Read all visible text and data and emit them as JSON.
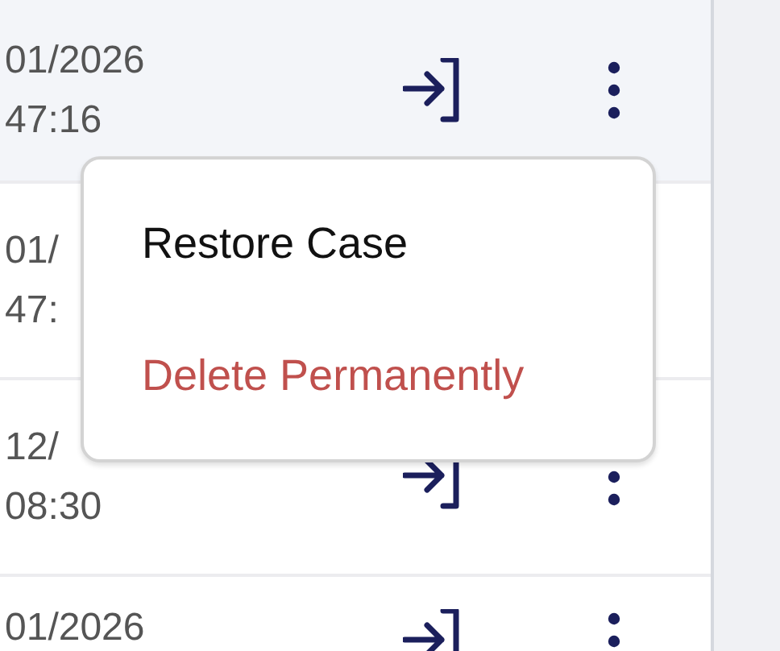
{
  "rows": [
    {
      "date": "01/2026",
      "time": "47:16",
      "selected": true,
      "actions": [
        {
          "kind": "enter"
        },
        {
          "kind": "more"
        }
      ]
    },
    {
      "date": "01/",
      "time": "47:",
      "selected": false
    },
    {
      "date": "12/",
      "time": "08:30",
      "selected": false,
      "actions": [
        {
          "kind": "enter"
        },
        {
          "kind": "more"
        }
      ]
    },
    {
      "date": "01/2026",
      "selected": false,
      "actions": [
        {
          "kind": "enter"
        },
        {
          "kind": "more"
        }
      ]
    }
  ],
  "menu": {
    "items": [
      {
        "label": "Restore Case",
        "kind": "normal"
      },
      {
        "label": "Delete Permanently",
        "kind": "danger"
      }
    ]
  }
}
